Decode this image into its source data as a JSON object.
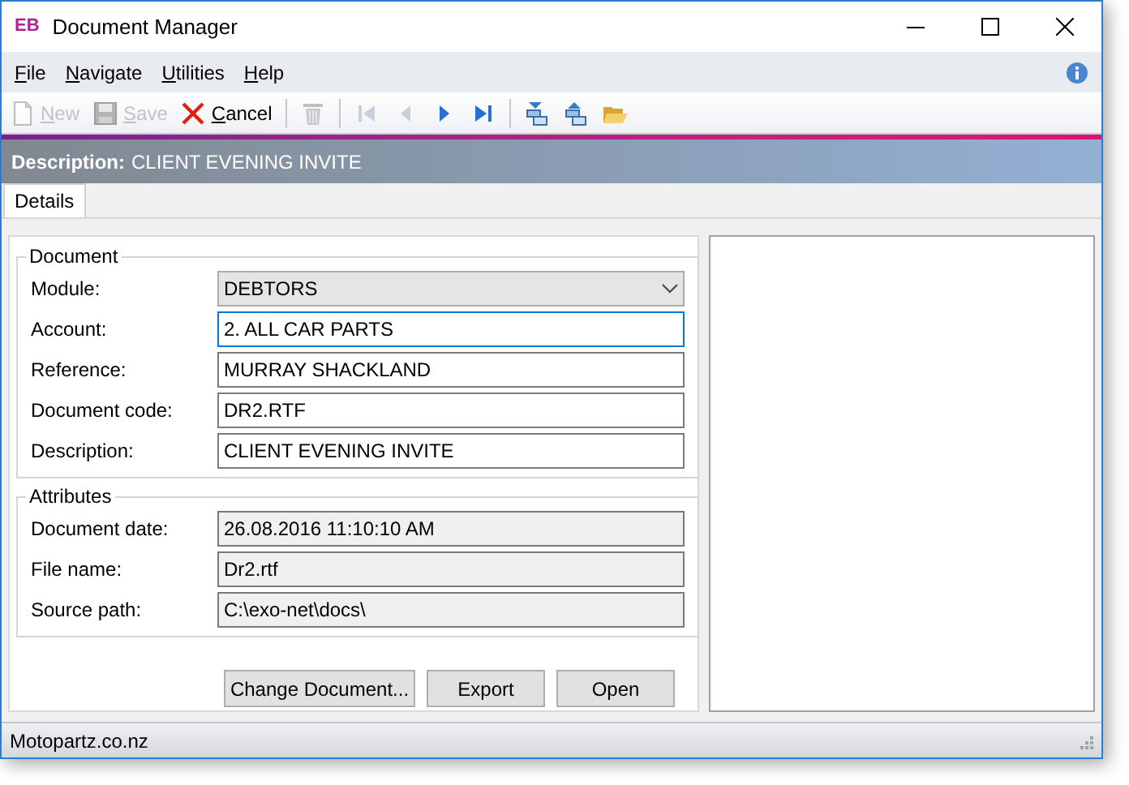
{
  "window": {
    "title": "Document Manager",
    "logo": "EB"
  },
  "menu": [
    {
      "label": "File"
    },
    {
      "label": "Navigate"
    },
    {
      "label": "Utilities"
    },
    {
      "label": "Help"
    }
  ],
  "toolbar": [
    {
      "kind": "new",
      "label": "New",
      "disabled": true
    },
    {
      "kind": "save",
      "label": "Save",
      "disabled": true
    },
    {
      "kind": "cancel",
      "label": "Cancel",
      "disabled": false
    },
    {
      "kind": "sep"
    },
    {
      "kind": "delete",
      "disabled": true
    },
    {
      "kind": "sep"
    },
    {
      "kind": "first",
      "disabled": true
    },
    {
      "kind": "prev",
      "disabled": true
    },
    {
      "kind": "next",
      "disabled": false
    },
    {
      "kind": "last",
      "disabled": false
    },
    {
      "kind": "sep"
    },
    {
      "kind": "down",
      "disabled": false
    },
    {
      "kind": "up",
      "disabled": false
    },
    {
      "kind": "open",
      "disabled": false
    }
  ],
  "description_bar": {
    "label": "Description:",
    "value": "CLIENT EVENING INVITE"
  },
  "tabs": [
    {
      "label": "Details",
      "selected": true
    }
  ],
  "groups": [
    {
      "title": "Document",
      "fields": [
        {
          "label": "Module:",
          "kind": "dropdown",
          "value": "DEBTORS",
          "read_only": false,
          "focused": false
        },
        {
          "label": "Account:",
          "kind": "text",
          "value": "2. ALL CAR PARTS",
          "read_only": false,
          "focused": true
        },
        {
          "label": "Reference:",
          "kind": "text",
          "value": "MURRAY SHACKLAND",
          "read_only": false,
          "focused": false
        },
        {
          "label": "Document code:",
          "kind": "text",
          "value": "DR2.RTF",
          "read_only": false,
          "focused": false
        },
        {
          "label": "Description:",
          "kind": "text",
          "value": "CLIENT EVENING INVITE",
          "read_only": false,
          "focused": false
        }
      ]
    },
    {
      "title": "Attributes",
      "fields": [
        {
          "label": "Document date:",
          "kind": "text",
          "value": "26.08.2016 11:10:10 AM",
          "read_only": true,
          "focused": false
        },
        {
          "label": "File name:",
          "kind": "text",
          "value": "Dr2.rtf",
          "read_only": true,
          "focused": false
        },
        {
          "label": "Source path:",
          "kind": "text",
          "value": "C:\\exo-net\\docs\\",
          "read_only": true,
          "focused": false
        }
      ]
    }
  ],
  "buttons": [
    {
      "label": "Change Document..."
    },
    {
      "label": "Export"
    },
    {
      "label": "Open"
    }
  ],
  "status_bar": {
    "text": "Motopartz.co.nz"
  }
}
